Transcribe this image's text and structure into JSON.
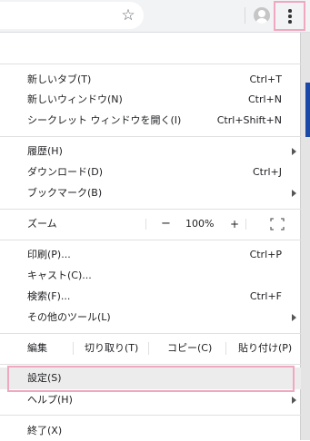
{
  "toolbar": {
    "star_icon": "star-outline-icon",
    "avatar_icon": "profile-avatar-icon",
    "menu_icon": "three-dot-vertical-icon"
  },
  "menu": {
    "group1": [
      {
        "label": "新しいタブ(T)",
        "shortcut": "Ctrl+T"
      },
      {
        "label": "新しいウィンドウ(N)",
        "shortcut": "Ctrl+N"
      },
      {
        "label": "シークレット ウィンドウを開く(I)",
        "shortcut": "Ctrl+Shift+N"
      }
    ],
    "group2": [
      {
        "label": "履歴(H)",
        "shortcut": ""
      },
      {
        "label": "ダウンロード(D)",
        "shortcut": "Ctrl+J"
      },
      {
        "label": "ブックマーク(B)",
        "shortcut": ""
      }
    ],
    "zoom": {
      "label": "ズーム",
      "minus": "−",
      "value": "100%",
      "plus": "+"
    },
    "group3": [
      {
        "label": "印刷(P)...",
        "shortcut": "Ctrl+P"
      },
      {
        "label": "キャスト(C)...",
        "shortcut": ""
      },
      {
        "label": "検索(F)...",
        "shortcut": "Ctrl+F"
      },
      {
        "label": "その他のツール(L)",
        "shortcut": ""
      }
    ],
    "edit": {
      "label": "編集",
      "cut": "切り取り(T)",
      "copy": "コピー(C)",
      "paste": "貼り付け(P)"
    },
    "group4": [
      {
        "label": "設定(S)"
      },
      {
        "label": "ヘルプ(H)"
      }
    ],
    "group5": [
      {
        "label": "終了(X)"
      }
    ]
  },
  "colors": {
    "highlight_outline": "#f0a7c0",
    "hover_bg": "#ececec",
    "accent": "#1a49a8"
  }
}
